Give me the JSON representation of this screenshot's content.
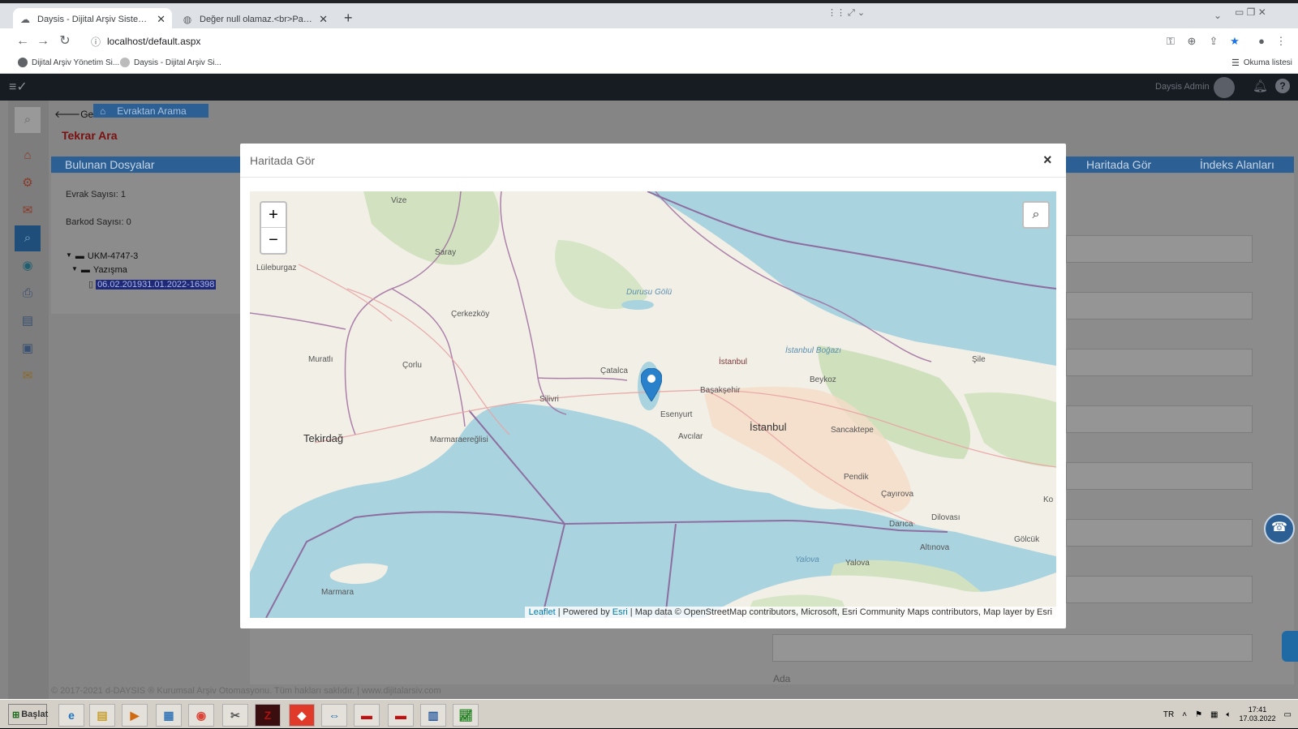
{
  "browser": {
    "tabs": [
      {
        "label": "Daysis - Dijital Arşiv Sistemleri",
        "active": true
      },
      {
        "label": "Değer null olamaz.<br>Parametre adı: …",
        "active": false
      }
    ],
    "new_tab": "+",
    "address": "localhost/default.aspx",
    "bookmarks": [
      "Dijital Arşiv Yönetim Si...",
      "Daysis - Dijital Arşiv Si..."
    ],
    "reading_list": "Okuma listesi"
  },
  "app": {
    "user_name": "Daysis Admin",
    "back_label": "Geri",
    "breadcrumb": "Evraktan Arama",
    "tekrar_ara": "Tekrar Ara",
    "bulunan_dosyalar": "Bulunan Dosyalar",
    "haritada_gor_tab": "Haritada Gör",
    "indeks_alanlari": "İndeks Alanları",
    "evrak_sayisi": "Evrak Sayısı: 1",
    "barkod_sayisi": "Barkod Sayısı: 0",
    "tree": {
      "root": "UKM-4747-3",
      "folder": "Yazışma",
      "file": "06.02.201931.01.2022-16398"
    },
    "field_label_ada": "Ada",
    "footer": "© 2017-2021 d-DAYSIS ® Kurumsal Arşiv Otomasyonu. Tüm hakları saklıdır. | www.dijitalarsiv.com"
  },
  "modal": {
    "title": "Haritada Gör",
    "close": "×",
    "zoom_in": "+",
    "zoom_out": "−",
    "attribution": {
      "leaflet": "Leaflet",
      "powered": "| Powered by",
      "esri": "Esri",
      "rest": "| Map data © OpenStreetMap contributors, Microsoft, Esri Community Maps contributors, Map layer by Esri"
    },
    "place_labels": {
      "vize": "Vize",
      "saray": "Saray",
      "luleburgaz": "Lüleburgaz",
      "cerkezkoy": "Çerkezköy",
      "muratli": "Muratlı",
      "corlu": "Çorlu",
      "catalca": "Çatalca",
      "silivri": "Silivri",
      "tekirdag": "Tekirdağ",
      "marmaraereglisi": "Marmaraereğlisi",
      "durusu": "Durusu Gölü",
      "istanbul_n": "İstanbul",
      "istanbul_bogazi": "İstanbul Boğazı",
      "sile": "Şile",
      "beykoz": "Beykoz",
      "basaksehir": "Başakşehir",
      "esenyurt": "Esenyurt",
      "avcilar": "Avcılar",
      "istanbul": "İstanbul",
      "sancaktepe": "Sancaktepe",
      "pendik": "Pendik",
      "cayirova": "Çayırova",
      "darica": "Darıca",
      "dilovasi": "Dilovası",
      "ko": "Ko",
      "golcuk": "Gölcük",
      "altinova": "Altınova",
      "yalova_water": "Yalova",
      "yalova": "Yalova",
      "marmara": "Marmara"
    },
    "marker_color": "#2a81cb"
  },
  "taskbar": {
    "start": "Başlat",
    "lang": "TR",
    "time": "17:41",
    "date": "17.03.2022"
  }
}
